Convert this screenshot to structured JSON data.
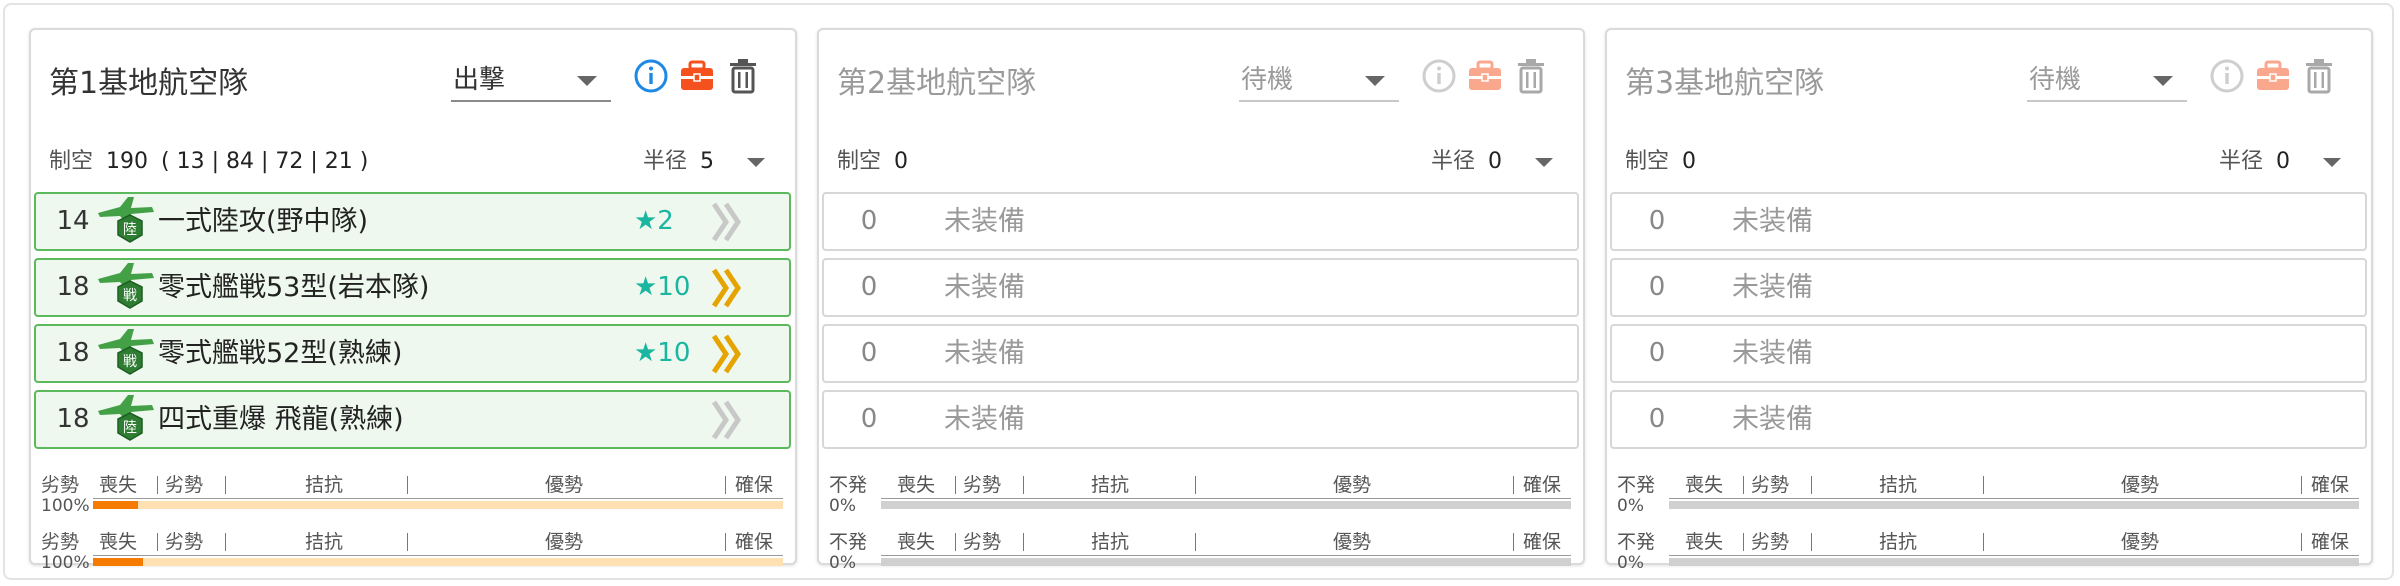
{
  "corps": [
    {
      "title": "第1基地航空隊",
      "mode": "出撃",
      "air_power_label": "制空",
      "air_power": "190",
      "air_power_detail": "( 13 | 84 | 72 | 21 )",
      "radius_label": "半径",
      "radius": "5",
      "slots": [
        {
          "count": "14",
          "type_badge": "陸",
          "name": "一式陸攻(野中隊)",
          "improvement": "★2",
          "proficiency": "grey"
        },
        {
          "count": "18",
          "type_badge": "戦",
          "name": "零式艦戦53型(岩本隊)",
          "improvement": "★10",
          "proficiency": "gold"
        },
        {
          "count": "18",
          "type_badge": "戦",
          "name": "零式艦戦52型(熟練)",
          "improvement": "★10",
          "proficiency": "gold"
        },
        {
          "count": "18",
          "type_badge": "陸",
          "name": "四式重爆 飛龍(熟練)",
          "improvement": "",
          "proficiency": "grey"
        }
      ],
      "gauges": [
        {
          "state": "劣勢",
          "percent": "100%",
          "fill_fraction": 0.065,
          "labels": [
            "喪失",
            "劣勢",
            "拮抗",
            "優勢",
            "確保"
          ]
        },
        {
          "state": "劣勢",
          "percent": "100%",
          "fill_fraction": 0.072,
          "labels": [
            "喪失",
            "劣勢",
            "拮抗",
            "優勢",
            "確保"
          ]
        }
      ]
    },
    {
      "title": "第2基地航空隊",
      "mode": "待機",
      "air_power_label": "制空",
      "air_power": "0",
      "air_power_detail": "",
      "radius_label": "半径",
      "radius": "0",
      "slots": [
        {
          "count": "0",
          "name": "未装備"
        },
        {
          "count": "0",
          "name": "未装備"
        },
        {
          "count": "0",
          "name": "未装備"
        },
        {
          "count": "0",
          "name": "未装備"
        }
      ],
      "gauges": [
        {
          "state": "不発",
          "percent": "0%",
          "fill_fraction": 0,
          "labels": [
            "喪失",
            "劣勢",
            "拮抗",
            "優勢",
            "確保"
          ]
        },
        {
          "state": "不発",
          "percent": "0%",
          "fill_fraction": 0,
          "labels": [
            "喪失",
            "劣勢",
            "拮抗",
            "優勢",
            "確保"
          ]
        }
      ]
    },
    {
      "title": "第3基地航空隊",
      "mode": "待機",
      "air_power_label": "制空",
      "air_power": "0",
      "air_power_detail": "",
      "radius_label": "半径",
      "radius": "0",
      "slots": [
        {
          "count": "0",
          "name": "未装備"
        },
        {
          "count": "0",
          "name": "未装備"
        },
        {
          "count": "0",
          "name": "未装備"
        },
        {
          "count": "0",
          "name": "未装備"
        }
      ],
      "gauges": [
        {
          "state": "不発",
          "percent": "0%",
          "fill_fraction": 0,
          "labels": [
            "喪失",
            "劣勢",
            "拮抗",
            "優勢",
            "確保"
          ]
        },
        {
          "state": "不発",
          "percent": "0%",
          "fill_fraction": 0,
          "labels": [
            "喪失",
            "劣勢",
            "拮抗",
            "優勢",
            "確保"
          ]
        }
      ]
    }
  ],
  "icons": {
    "info": "info-icon",
    "bag": "toolbox-icon",
    "trash": "trash-icon",
    "plane": "plane-icon",
    "proficiency": "chevron-proficiency-icon"
  },
  "colors": {
    "equipped_border": "#5cb95c",
    "equipped_bg": "#eef8ee",
    "star": "#1bb6a0",
    "gauge_fill": "#f57c00",
    "gauge_track": "#ffe0b2",
    "info_blue": "#1e88e5",
    "bag_orange": "#f4511e",
    "gold": "#e6a400"
  }
}
